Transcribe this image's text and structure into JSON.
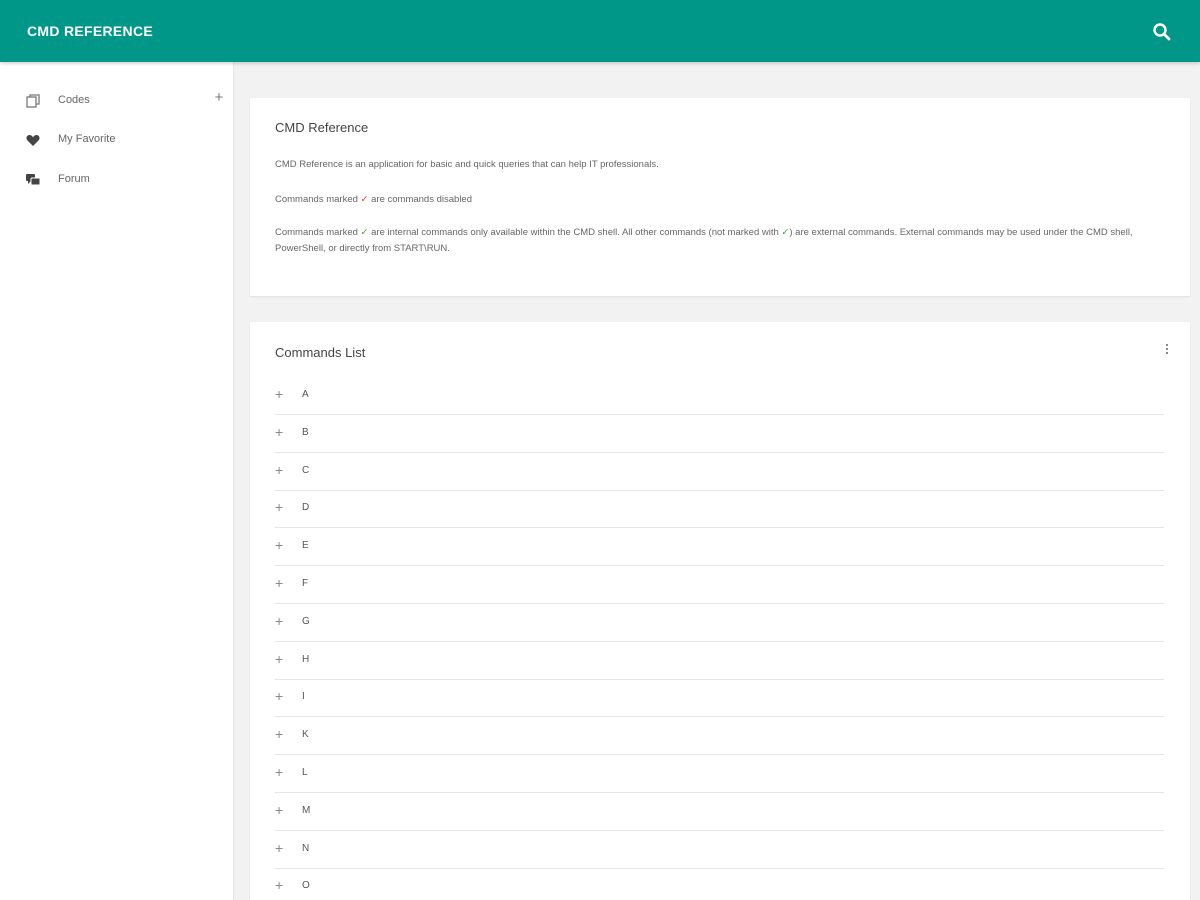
{
  "header": {
    "title": "CMD REFERENCE",
    "search_icon": "search-icon"
  },
  "sidebar": {
    "items": [
      {
        "label": "Codes",
        "icon": "copy-icon",
        "has_add": true
      },
      {
        "label": "My Favorite",
        "icon": "heart-icon"
      },
      {
        "label": "Forum",
        "icon": "chat-icon"
      }
    ],
    "add_symbol": "+"
  },
  "info": {
    "title": "CMD Reference",
    "p1": "CMD Reference is an application for basic and quick queries that can help IT professionals.",
    "p2_before": "Commands marked ",
    "p2_after": " are commands disabled",
    "p3_before": "Commands marked ",
    "p3_middle": " are internal commands only available within the CMD shell. All other commands (not marked with ",
    "p3_after": ") are external commands. External commands may be used under the CMD shell, PowerShell, or directly from START\\RUN.",
    "check_mark": "✓",
    "colors": {
      "disabled": "#e53935",
      "internal": "#43a047"
    }
  },
  "commands": {
    "title": "Commands List",
    "expand_symbol": "+",
    "letters": [
      "A",
      "B",
      "C",
      "D",
      "E",
      "F",
      "G",
      "H",
      "I",
      "K",
      "L",
      "M",
      "N",
      "O"
    ]
  },
  "colors": {
    "accent": "#009688"
  }
}
